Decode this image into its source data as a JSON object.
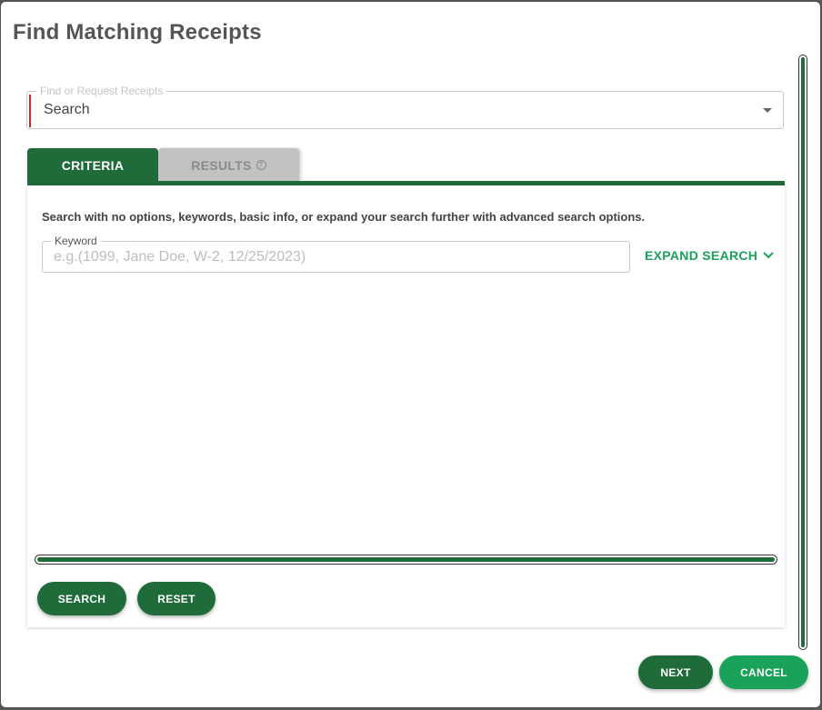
{
  "dialog": {
    "title": "Find Matching Receipts"
  },
  "request_select": {
    "label": "Find or Request Receipts",
    "value": "Search"
  },
  "tabs": [
    {
      "label": "CRITERIA",
      "active": true
    },
    {
      "label": "RESULTS",
      "active": false,
      "icon": "help-circle-icon"
    }
  ],
  "criteria": {
    "intro": "Search with no options, keywords, basic info, or expand your search further with advanced search options.",
    "keyword": {
      "label": "Keyword",
      "value": "",
      "placeholder": "e.g.(1099, Jane Doe, W-2, 12/25/2023)"
    },
    "expand_label": "EXPAND SEARCH",
    "search_label": "SEARCH",
    "reset_label": "RESET"
  },
  "footer": {
    "next_label": "NEXT",
    "cancel_label": "CANCEL"
  },
  "colors": {
    "primary_dark_green": "#1f6b3a",
    "accent_green": "#1aa15a",
    "tab_inactive": "#c2c2c2",
    "required_accent": "#c62828"
  }
}
